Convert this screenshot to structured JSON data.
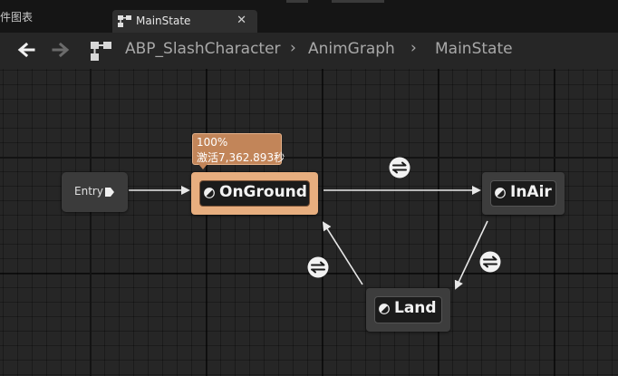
{
  "tabs": {
    "previous_label": "件图表",
    "active_label": "MainState",
    "close_symbol": "✕"
  },
  "breadcrumb": {
    "items": [
      "ABP_SlashCharacter",
      "AnimGraph",
      "MainState"
    ],
    "separator": "›"
  },
  "graph": {
    "entry": {
      "label": "Entry"
    },
    "states": {
      "onground": {
        "label": "OnGround",
        "active": true
      },
      "inair": {
        "label": "InAir"
      },
      "land": {
        "label": "Land"
      }
    },
    "tooltip": {
      "percent": "100%",
      "active_time": "激活7,362.893秒"
    },
    "transitions": [
      "onground-to-inair",
      "inair-to-land",
      "land-to-onground"
    ]
  },
  "colors": {
    "active_state": "#e7ae7f",
    "tooltip_bg": "#c28559",
    "state_bg": "#3d3d3d",
    "wire": "#e8e8e8"
  },
  "icons": {
    "back": "arrow-left-icon",
    "forward": "arrow-right-icon",
    "graph": "state-machine-icon",
    "state": "half-circle-icon",
    "transition": "bidirectional-arrows-icon"
  }
}
